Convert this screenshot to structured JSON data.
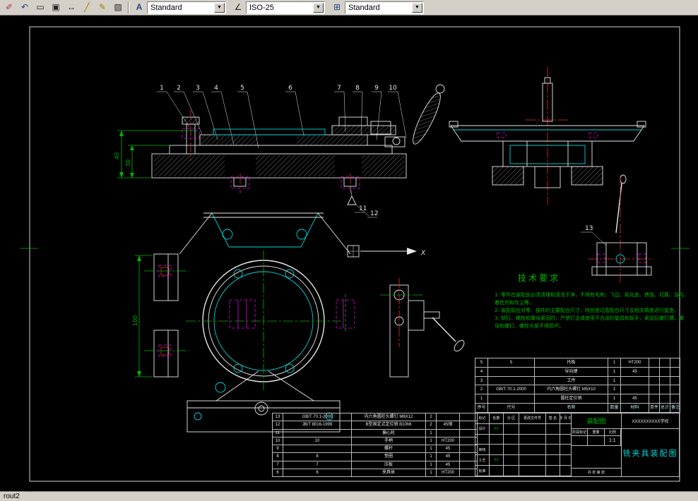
{
  "colors": {
    "bg": "#000000",
    "chrome": "#d4d0c8",
    "line": "#e8e8e8",
    "cyan": "#00d7d7",
    "green": "#00b400",
    "red": "#e03030",
    "magenta": "#e800e8"
  },
  "toolbar": {
    "text_style": "Standard",
    "dim_style": "ISO-25",
    "table_style": "Standard"
  },
  "statusbar": {
    "layout_tab": "rout2"
  },
  "drawing": {
    "callouts": [
      "1",
      "2",
      "3",
      "4",
      "5",
      "6",
      "7",
      "8",
      "9",
      "10",
      "11",
      "12",
      "13"
    ],
    "dims": {
      "d40": "40",
      "d30": "30",
      "d100": "100"
    },
    "axis_x": "X",
    "tech": {
      "title": "技术要求",
      "lines": [
        "1: 零件在装配前必须清理和清洗干净，不得有毛刺、飞边、氧化皮、锈蚀、切屑、油污、",
        "着色剂和灰尘等。",
        "2: 装配前应对零、部件的主要配合尺寸，特别是过盈配合尺寸及相关精度进行复查。",
        "3: 铆钉、螺栓和螺母紧固时，严禁打击或使用不合适的旋具和扳手，紧固后螺钉槽、螺",
        "母和螺钉、螺栓头部不得损坏。"
      ]
    }
  },
  "bom_upper": {
    "headers": [
      "序号",
      "代号",
      "名称",
      "数量",
      "材料",
      "单件",
      "总计",
      "备注"
    ],
    "rows": [
      [
        "5",
        "5",
        "托板",
        "1",
        "HT200",
        "",
        "",
        ""
      ],
      [
        "4",
        "",
        "导向键",
        "1",
        "45",
        "",
        "",
        ""
      ],
      [
        "3",
        "",
        "工件",
        "1",
        "",
        "",
        "",
        ""
      ],
      [
        "2",
        "GB/T 70.1-2000",
        "内六角圆柱头螺钉 M5X10",
        "1",
        "",
        "",
        "",
        ""
      ],
      [
        "1",
        "",
        "圆柱定位销",
        "1",
        "45",
        "",
        "",
        ""
      ]
    ]
  },
  "bom_lower": {
    "rows": [
      [
        "13",
        "GB/T 70.1-2000",
        "内六角圆柱头螺钉 M6X12",
        "2",
        "",
        ""
      ],
      [
        "12",
        "JB/T 8016-1999",
        "B型固定式定位销 B10h6",
        "2",
        "45钢",
        ""
      ],
      [
        "11",
        "",
        "偏心轮",
        "1",
        "",
        ""
      ],
      [
        "10",
        "10",
        "手柄",
        "1",
        "HT200",
        ""
      ],
      [
        "9",
        "",
        "螺杆",
        "1",
        "45",
        ""
      ],
      [
        "8",
        "8",
        "垫圈",
        "1",
        "45",
        ""
      ],
      [
        "7",
        "7",
        "压板",
        "1",
        "45",
        ""
      ],
      [
        "6",
        "6",
        "夹具体",
        "1",
        "HT200",
        ""
      ]
    ]
  },
  "title_block": {
    "type_label": "装配图",
    "school": "XXXXXXXXXX学校",
    "drawing_title": "铣夹具装配图",
    "stage_label": "阶段标记",
    "weight_label": "重量",
    "scale_label": "比例",
    "scale_value": "1:1",
    "sheets_label": "共 张 第 张",
    "left_grid": [
      [
        "标记",
        "处数",
        "分 区",
        "更改文件号",
        "签 名",
        "年 月 日"
      ],
      [
        "设计",
        "XX",
        "",
        "",
        "",
        ""
      ],
      [
        "",
        "",
        "",
        "",
        "",
        ""
      ],
      [
        "审核",
        "",
        "",
        "",
        "",
        ""
      ],
      [
        "工艺",
        "XX",
        "",
        "",
        "",
        ""
      ],
      [
        "批准",
        "",
        "",
        "",
        "",
        ""
      ]
    ]
  }
}
